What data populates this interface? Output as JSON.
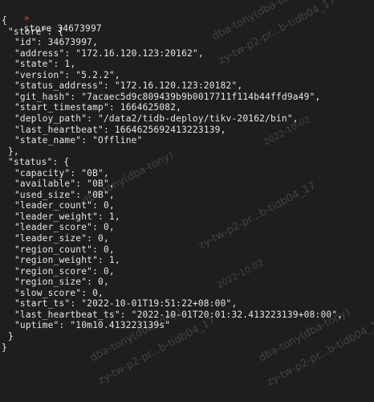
{
  "terminal": {
    "prompt_symbol": "»",
    "command": "store 34673997",
    "lines": [
      {
        "indent": 0,
        "text": "{"
      },
      {
        "indent": 1,
        "text": "\"store\": {"
      },
      {
        "indent": 2,
        "text": "\"id\": 34673997,"
      },
      {
        "indent": 2,
        "text": "\"address\": \"172.16.120.123:20162\","
      },
      {
        "indent": 2,
        "text": "\"state\": 1,"
      },
      {
        "indent": 2,
        "text": "\"version\": \"5.2.2\","
      },
      {
        "indent": 2,
        "text": "\"status_address\": \"172.16.120.123:20182\","
      },
      {
        "indent": 2,
        "text": "\"git_hash\": \"7acaec5d9c809439b9b0017711f114b44ffd9a49\","
      },
      {
        "indent": 2,
        "text": "\"start_timestamp\": 1664625082,"
      },
      {
        "indent": 2,
        "text": "\"deploy_path\": \"/data2/tidb-deploy/tikv-20162/bin\","
      },
      {
        "indent": 2,
        "text": "\"last_heartbeat\": 1664625692413223139,"
      },
      {
        "indent": 2,
        "text": "\"state_name\": \"Offline\""
      },
      {
        "indent": 1,
        "text": "},"
      },
      {
        "indent": 1,
        "text": "\"status\": {"
      },
      {
        "indent": 2,
        "text": "\"capacity\": \"0B\","
      },
      {
        "indent": 2,
        "text": "\"available\": \"0B\","
      },
      {
        "indent": 2,
        "text": "\"used_size\": \"0B\","
      },
      {
        "indent": 2,
        "text": "\"leader_count\": 0,"
      },
      {
        "indent": 2,
        "text": "\"leader_weight\": 1,"
      },
      {
        "indent": 2,
        "text": "\"leader_score\": 0,"
      },
      {
        "indent": 2,
        "text": "\"leader_size\": 0,"
      },
      {
        "indent": 2,
        "text": "\"region_count\": 0,"
      },
      {
        "indent": 2,
        "text": "\"region_weight\": 1,"
      },
      {
        "indent": 2,
        "text": "\"region_score\": 0,"
      },
      {
        "indent": 2,
        "text": "\"region_size\": 0,"
      },
      {
        "indent": 2,
        "text": "\"slow_score\": 0,"
      },
      {
        "indent": 2,
        "text": "\"start_ts\": \"2022-10-01T19:51:22+08:00\","
      },
      {
        "indent": 2,
        "text": "\"last_heartbeat_ts\": \"2022-10-01T20:01:32.413223139+08:00\","
      },
      {
        "indent": 2,
        "text": "\"uptime\": \"10m10.413223139s\""
      },
      {
        "indent": 1,
        "text": "}"
      },
      {
        "indent": 0,
        "text": "}"
      }
    ]
  },
  "watermarks": [
    "dba-tony(dba-tony)",
    "zy-tw-p2-pr...b-tidb04_17",
    "2022-10-02",
    "dba-tony(dba-tony)",
    "zy-tw-p2-pr...b-tidb04_17",
    "2022-10-02",
    "dba-tony(dba-tony)",
    "zy-tw-p2-pr...b-tidb04_17",
    "dba-tony(dba-tony)",
    "zy-tw-p2-pr...b-tidb04_17"
  ]
}
